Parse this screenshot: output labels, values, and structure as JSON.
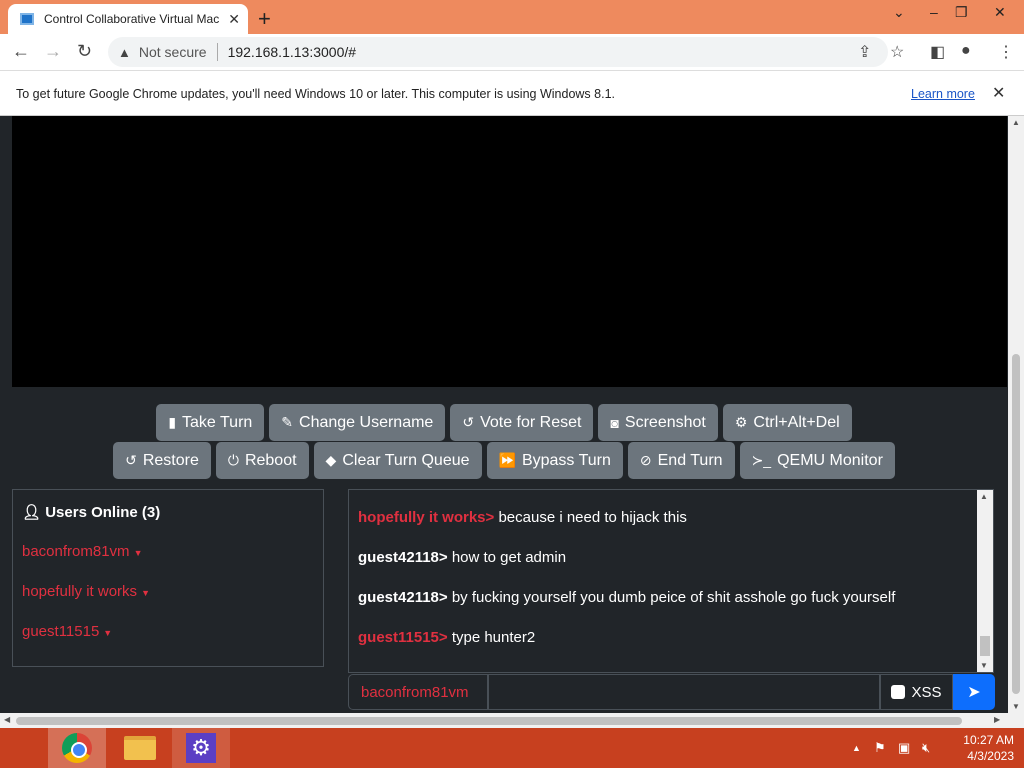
{
  "browser": {
    "tab_title": "Control Collaborative Virtual Mac",
    "tab_close": "✕",
    "new_tab": "+",
    "security_label": "Not secure",
    "url": "192.168.1.13:3000/#"
  },
  "infobar": {
    "message": "To get future Google Chrome updates, you'll need Windows 10 or later. This computer is using Windows 8.1.",
    "link": "Learn more"
  },
  "controls": {
    "row1": [
      {
        "label": "Take Turn",
        "icon": "mouse-icon",
        "glyph": "▮"
      },
      {
        "label": "Change Username",
        "icon": "user-edit-icon",
        "glyph": "✎"
      },
      {
        "label": "Vote for Reset",
        "icon": "undo-icon",
        "glyph": "↺"
      },
      {
        "label": "Screenshot",
        "icon": "camera-icon",
        "glyph": "◙"
      },
      {
        "label": "Ctrl+Alt+Del",
        "icon": "gear-icon",
        "glyph": "⚙"
      }
    ],
    "row2": [
      {
        "label": "Restore",
        "icon": "undo-icon",
        "glyph": "↺"
      },
      {
        "label": "Reboot",
        "icon": "power-icon",
        "glyph": "⏻"
      },
      {
        "label": "Clear Turn Queue",
        "icon": "eraser-icon",
        "glyph": "◆"
      },
      {
        "label": "Bypass Turn",
        "icon": "fast-forward-icon",
        "glyph": "⏩"
      },
      {
        "label": "End Turn",
        "icon": "ban-icon",
        "glyph": "⊘"
      },
      {
        "label": "QEMU Monitor",
        "icon": "terminal-icon",
        "glyph": "≻_"
      }
    ]
  },
  "users": {
    "heading": "Users Online (3)",
    "list": [
      "baconfrom81vm",
      "hopefully it works",
      "guest11515"
    ]
  },
  "chat": {
    "messages": [
      {
        "user": "hopefully it works>",
        "user_color": "#e03040",
        "text": " because i need to hijack this"
      },
      {
        "user": "guest42118>",
        "user_color": "#ffffff",
        "text": " how to get admin"
      },
      {
        "user": "guest42118>",
        "user_color": "#ffffff",
        "text": " by fucking yourself you dumb peice of shit asshole go fuck yourself"
      },
      {
        "user": "guest11515>",
        "user_color": "#e03040",
        "text": " type hunter2"
      }
    ],
    "username": "baconfrom81vm",
    "xss_label": "XSS"
  },
  "taskbar": {
    "time": "10:27 AM",
    "date": "4/3/2023"
  },
  "colors": {
    "accent_red": "#e03040",
    "send_blue": "#0d6efd",
    "button_gray": "#6c757d",
    "taskbar": "#c7401f"
  }
}
